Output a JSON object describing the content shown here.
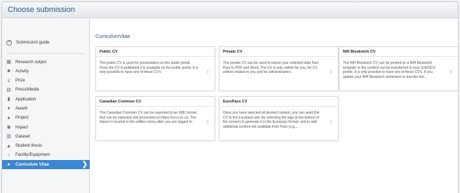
{
  "dialog": {
    "title": "Choose submission"
  },
  "sidebar": {
    "guide": {
      "icon": "help-circle-icon",
      "label": "Submission guide"
    },
    "items": [
      {
        "icon": "book-icon",
        "glyph": "▦",
        "label": "Research output"
      },
      {
        "icon": "briefcase-icon",
        "glyph": "■",
        "label": "Activity"
      },
      {
        "icon": "trophy-icon",
        "glyph": "♕",
        "label": "Prize"
      },
      {
        "icon": "newspaper-icon",
        "glyph": "▤",
        "label": "Press/Media"
      },
      {
        "icon": "bar-chart-icon",
        "glyph": "▮",
        "label": "Application"
      },
      {
        "icon": "award-icon",
        "glyph": "♦",
        "label": "Award"
      },
      {
        "icon": "project-icon",
        "glyph": "●",
        "label": "Project"
      },
      {
        "icon": "impact-icon",
        "glyph": "◉",
        "label": "Impact"
      },
      {
        "icon": "dataset-icon",
        "glyph": "▥",
        "label": "Dataset"
      },
      {
        "icon": "graduation-cap-icon",
        "glyph": "▲",
        "label": "Student thesis"
      },
      {
        "icon": "facility-icon",
        "glyph": "○",
        "label": "Facility/Equipment"
      },
      {
        "icon": "curriculum-icon",
        "glyph": "●",
        "label": "Curriculum Vitae",
        "active": true
      }
    ]
  },
  "main": {
    "section_title": "CurriculumVitae",
    "cards": [
      {
        "title": "Public CV",
        "description": "The public CV is used for presentation on the public portal. Once the CV is published it is available on the public portal. It is only possible to have one of these CV's."
      },
      {
        "title": "Private CV",
        "description": "The private CV can be used to export your selected data from Pure to PDF and Word. The CV is only visible for you, for CV editors related to you and for administrators."
      },
      {
        "title": "NIH Biosketch CV",
        "description": "The NIH Biosketch CV can be printed on a NIH Biosketch template or the content can be transferred to your SciENCV profile. It is only possible to have one of these CV's. If you update your NIH Biosketch remember to transfer the..."
      },
      {
        "title": "Canadian Common CV",
        "description": "The Canadian Common CV can be exported to an XML format that can be imported and processed on https://ccv-cvc.ca. The import is located in the utilities menu after you are logged in."
      },
      {
        "title": "EuroPass CV",
        "description": "Once you have selected all desired content, you can send this CV to the Europass site (by selecting the logo at the bottom of the screen) to generate it in the Europass format, and to add additional content not available from Pure (e.g...."
      }
    ]
  }
}
